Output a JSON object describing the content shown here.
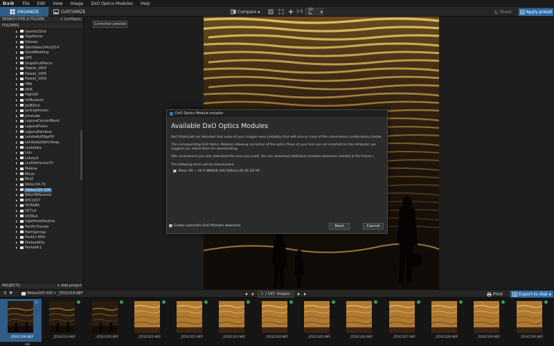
{
  "app": {
    "logo": "DxO"
  },
  "menu": [
    "File",
    "Edit",
    "View",
    "Image",
    "DxO Optics Modules",
    "Help"
  ],
  "toolbar": {
    "organize_label": "ORGANIZE",
    "customize_label": "CUSTOMIZE",
    "compare_label": "Compare",
    "ratio_label": "1:1",
    "zoom_value": "22 %",
    "reset_label": "Reset",
    "apply_preset_label": "Apply preset"
  },
  "left_panel": {
    "search_label": "SEARCH FOR A FOLDER",
    "configure_label": "+ Configure",
    "folders_label": "FOLDERS",
    "folders": [
      {
        "name": "Garetts32nd",
        "selected": false
      },
      {
        "name": "GigaPanos",
        "selected": false
      },
      {
        "name": "Glasses",
        "selected": false
      },
      {
        "name": "GlenHelen24hr2014",
        "selected": false
      },
      {
        "name": "GoodWedding",
        "selected": false
      },
      {
        "name": "GPS",
        "selected": false
      },
      {
        "name": "GrapefruitMacro",
        "selected": false
      },
      {
        "name": "Hawaii_2003",
        "selected": false
      },
      {
        "name": "Hawaii_2005",
        "selected": false
      },
      {
        "name": "Hawaii_2016",
        "selected": false
      },
      {
        "name": "HBA",
        "selected": false
      },
      {
        "name": "HDR",
        "selected": false
      },
      {
        "name": "HighISO",
        "selected": false
      },
      {
        "name": "ImMuseum",
        "selected": false
      },
      {
        "name": "JanBZion",
        "selected": false
      },
      {
        "name": "JaniceJohnson",
        "selected": false
      },
      {
        "name": "JuneLake",
        "selected": false
      },
      {
        "name": "LagunaConcertBand",
        "selected": false
      },
      {
        "name": "LagunaFlutes",
        "selected": false
      },
      {
        "name": "LagunaRainbow",
        "selected": false
      },
      {
        "name": "LensbabyEdge50",
        "selected": false
      },
      {
        "name": "LensbabyOpticSwap",
        "selected": false
      },
      {
        "name": "LindaSala",
        "selected": false
      },
      {
        "name": "Lion",
        "selected": false
      },
      {
        "name": "LotusLA",
        "selected": false
      },
      {
        "name": "LouDelmonico75",
        "selected": false
      },
      {
        "name": "Malena",
        "selected": false
      },
      {
        "name": "Micon",
        "selected": false
      },
      {
        "name": "MrsZ",
        "selected": false
      },
      {
        "name": "Nikkor24-70",
        "selected": false
      },
      {
        "name": "Nikkor200-500",
        "selected": true
      },
      {
        "name": "NikonWALenses",
        "selected": false
      },
      {
        "name": "NYC2007",
        "selected": false
      },
      {
        "name": "OCA&BA",
        "selected": false
      },
      {
        "name": "OCTLA",
        "selected": false
      },
      {
        "name": "OCWLA",
        "selected": false
      },
      {
        "name": "OglethreeDeskins",
        "selected": false
      },
      {
        "name": "PacificChorale",
        "selected": false
      },
      {
        "name": "PalmSprings",
        "selected": false
      },
      {
        "name": "Paula's 80th",
        "selected": false
      },
      {
        "name": "Pentax645z",
        "selected": false
      },
      {
        "name": "PentaxK-1",
        "selected": false
      }
    ],
    "projects_label": "PROJECTS",
    "add_project_label": "+ Add project"
  },
  "main": {
    "correction_preview_label": "Correction preview"
  },
  "dialog": {
    "title": "DxO Optics Module installer",
    "heading": "Available DxO Optics Modules",
    "paragraph1": "DxO PhotoLab has detected that some of your images were probably shot with one or more of the camera/lens combinations below.",
    "paragraph2": "The corresponding DxO Optics Modules allowing correction of the optics flaws of your lens are not installed on the computer; we suggest you select them for downloading.",
    "paragraph3": "(We recommend you only download the ones you need. You can download additional modules whenever needed in the future.)",
    "items_label": "The following items will be downloaded",
    "items": [
      "Nikon D5 + AF-S NIKKOR 200-500mm f/5.6E ED VR"
    ],
    "auto_label": "Enable automatic DxO Modules download",
    "next_label": "Next",
    "cancel_label": "Cancel"
  },
  "bottom_bar": {
    "folder_path": "Nikkor200-500 > _D5S2318.NEF",
    "page_current": "1",
    "page_total": "/ 147",
    "page_unit": "images",
    "print_label": "Print",
    "export_label": "Export to disk"
  },
  "filmstrip": [
    {
      "name": "_D5S2318.NEF",
      "selected": true
    },
    {
      "name": "_D5S2319.NEF",
      "selected": false
    },
    {
      "name": "_D5S2320.NEF",
      "selected": false
    },
    {
      "name": "_D5S2321.NEF",
      "selected": false
    },
    {
      "name": "_D5S2322.NEF",
      "selected": false
    },
    {
      "name": "_D5S2323.NEF",
      "selected": false
    },
    {
      "name": "_D5S2324.NEF",
      "selected": false
    },
    {
      "name": "_D5S2325.NEF",
      "selected": false
    },
    {
      "name": "_D5S2326.NEF",
      "selected": false
    },
    {
      "name": "_D5S2327.NEF",
      "selected": false
    },
    {
      "name": "_D5S2328.NEF",
      "selected": false
    },
    {
      "name": "_D5S2329.NEF",
      "selected": false
    },
    {
      "name": "_D5S2330.NEF",
      "selected": false
    }
  ],
  "colors": {
    "accent": "#2f6ea8",
    "organize_tab": "#2f5e86",
    "selected_folder": "#3b6e9e",
    "filmstrip_badge": "#3c9c5a"
  }
}
